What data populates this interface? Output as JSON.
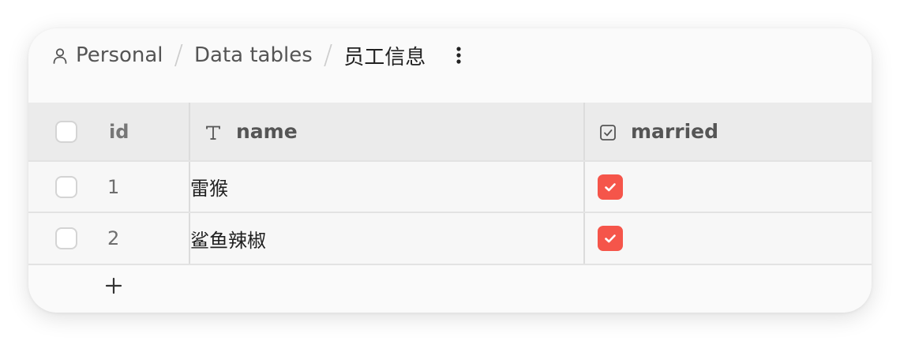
{
  "breadcrumb": {
    "items": [
      {
        "label": "Personal",
        "icon": "person-icon"
      },
      {
        "label": "Data tables"
      },
      {
        "label": "员工信息"
      }
    ],
    "separator": "/",
    "more_icon": "more-vertical-icon"
  },
  "table": {
    "columns": [
      {
        "label": "id"
      },
      {
        "label": "name",
        "icon": "text-type-icon"
      },
      {
        "label": "married",
        "icon": "checkbox-type-icon"
      }
    ],
    "rows": [
      {
        "id": "1",
        "name": "雷猴",
        "married": true
      },
      {
        "id": "2",
        "name": "鲨鱼辣椒",
        "married": true
      }
    ],
    "add_row_icon": "plus-icon"
  },
  "colors": {
    "accent": "#f5554a",
    "header_bg": "#ebebeb",
    "row_bg": "#f7f7f7",
    "card_bg": "#fafafa"
  }
}
